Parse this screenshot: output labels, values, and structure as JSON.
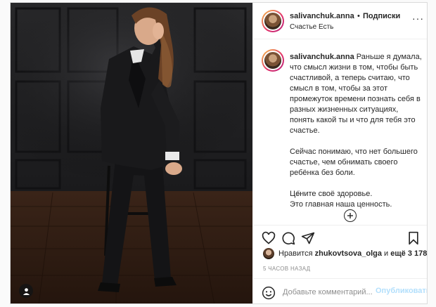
{
  "post": {
    "header": {
      "username": "salivanchuk.anna",
      "separator": "•",
      "follow_label": "Подписки",
      "location": "Счастье Есть",
      "more_icon": "more-horizontal-icon"
    },
    "caption": {
      "username": "salivanchuk.anna",
      "paragraphs": [
        "Раньше я думала, что смысл жизни в том, чтобы быть счастливой, а теперь считаю, что смысл в том, чтобы за этот промежуток времени познать себя в разных жизненных ситуациях, понять какой ты и что для тебя это счастье.",
        "Сейчас понимаю, что нет большего счастье, чем обнимать своего ребёнка без боли.",
        "Цените своё здоровье.\nЭто главная наша ценность."
      ],
      "time": "5 ч."
    },
    "actions": {
      "like_icon": "heart-icon",
      "comment_icon": "comment-icon",
      "share_icon": "share-icon",
      "save_icon": "bookmark-icon",
      "load_more_icon": "plus-circle-icon"
    },
    "likes": {
      "prefix": "Нравится",
      "user": "zhukovtsova_olga",
      "middle": "и",
      "count": "ещё 3 178"
    },
    "timestamp": "5 ЧАСОВ НАЗАД",
    "comment": {
      "placeholder": "Добавьте комментарий...",
      "publish_label": "Опубликовать",
      "publish_color": "#b2dffc"
    }
  }
}
